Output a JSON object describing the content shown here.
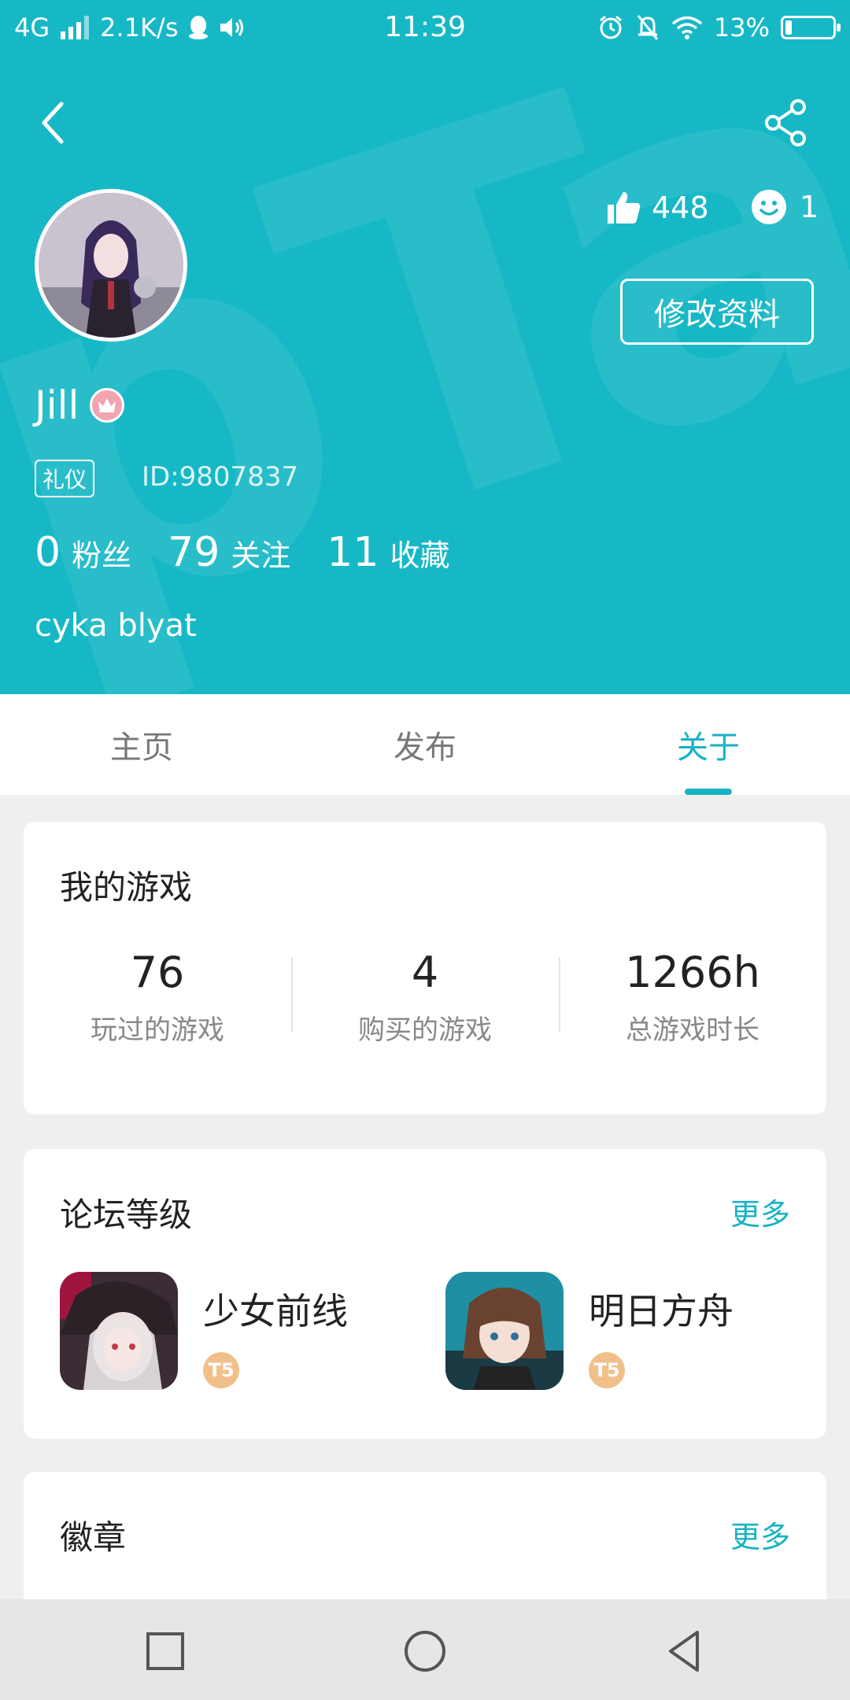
{
  "status_bar": {
    "network": "4G",
    "speed": "2.1K/s",
    "time": "11:39",
    "battery_percent": "13%",
    "battery_level": 0.13
  },
  "header": {
    "bg_color": "#17b8c6",
    "likes": "448",
    "smiles": "1",
    "edit_label": "修改资料",
    "username": "Jill",
    "tag": "礼仪",
    "user_id": "ID:9807837",
    "counts": [
      {
        "value": "0",
        "label": "粉丝"
      },
      {
        "value": "79",
        "label": "关注"
      },
      {
        "value": "11",
        "label": "收藏"
      }
    ],
    "bio": "cyka blyat"
  },
  "tabs": [
    {
      "label": "主页",
      "active": false
    },
    {
      "label": "发布",
      "active": false
    },
    {
      "label": "关于",
      "active": true
    }
  ],
  "my_games": {
    "title": "我的游戏",
    "stats": [
      {
        "value": "76",
        "label": "玩过的游戏"
      },
      {
        "value": "4",
        "label": "购买的游戏"
      },
      {
        "value": "1266h",
        "label": "总游戏时长"
      }
    ]
  },
  "forum_level": {
    "title": "论坛等级",
    "more": "更多",
    "items": [
      {
        "name": "少女前线",
        "level_badge": "T5"
      },
      {
        "name": "明日方舟",
        "level_badge": "T5"
      }
    ]
  },
  "badges": {
    "title": "徽章",
    "more": "更多"
  },
  "accent_color": "#18b3c2"
}
